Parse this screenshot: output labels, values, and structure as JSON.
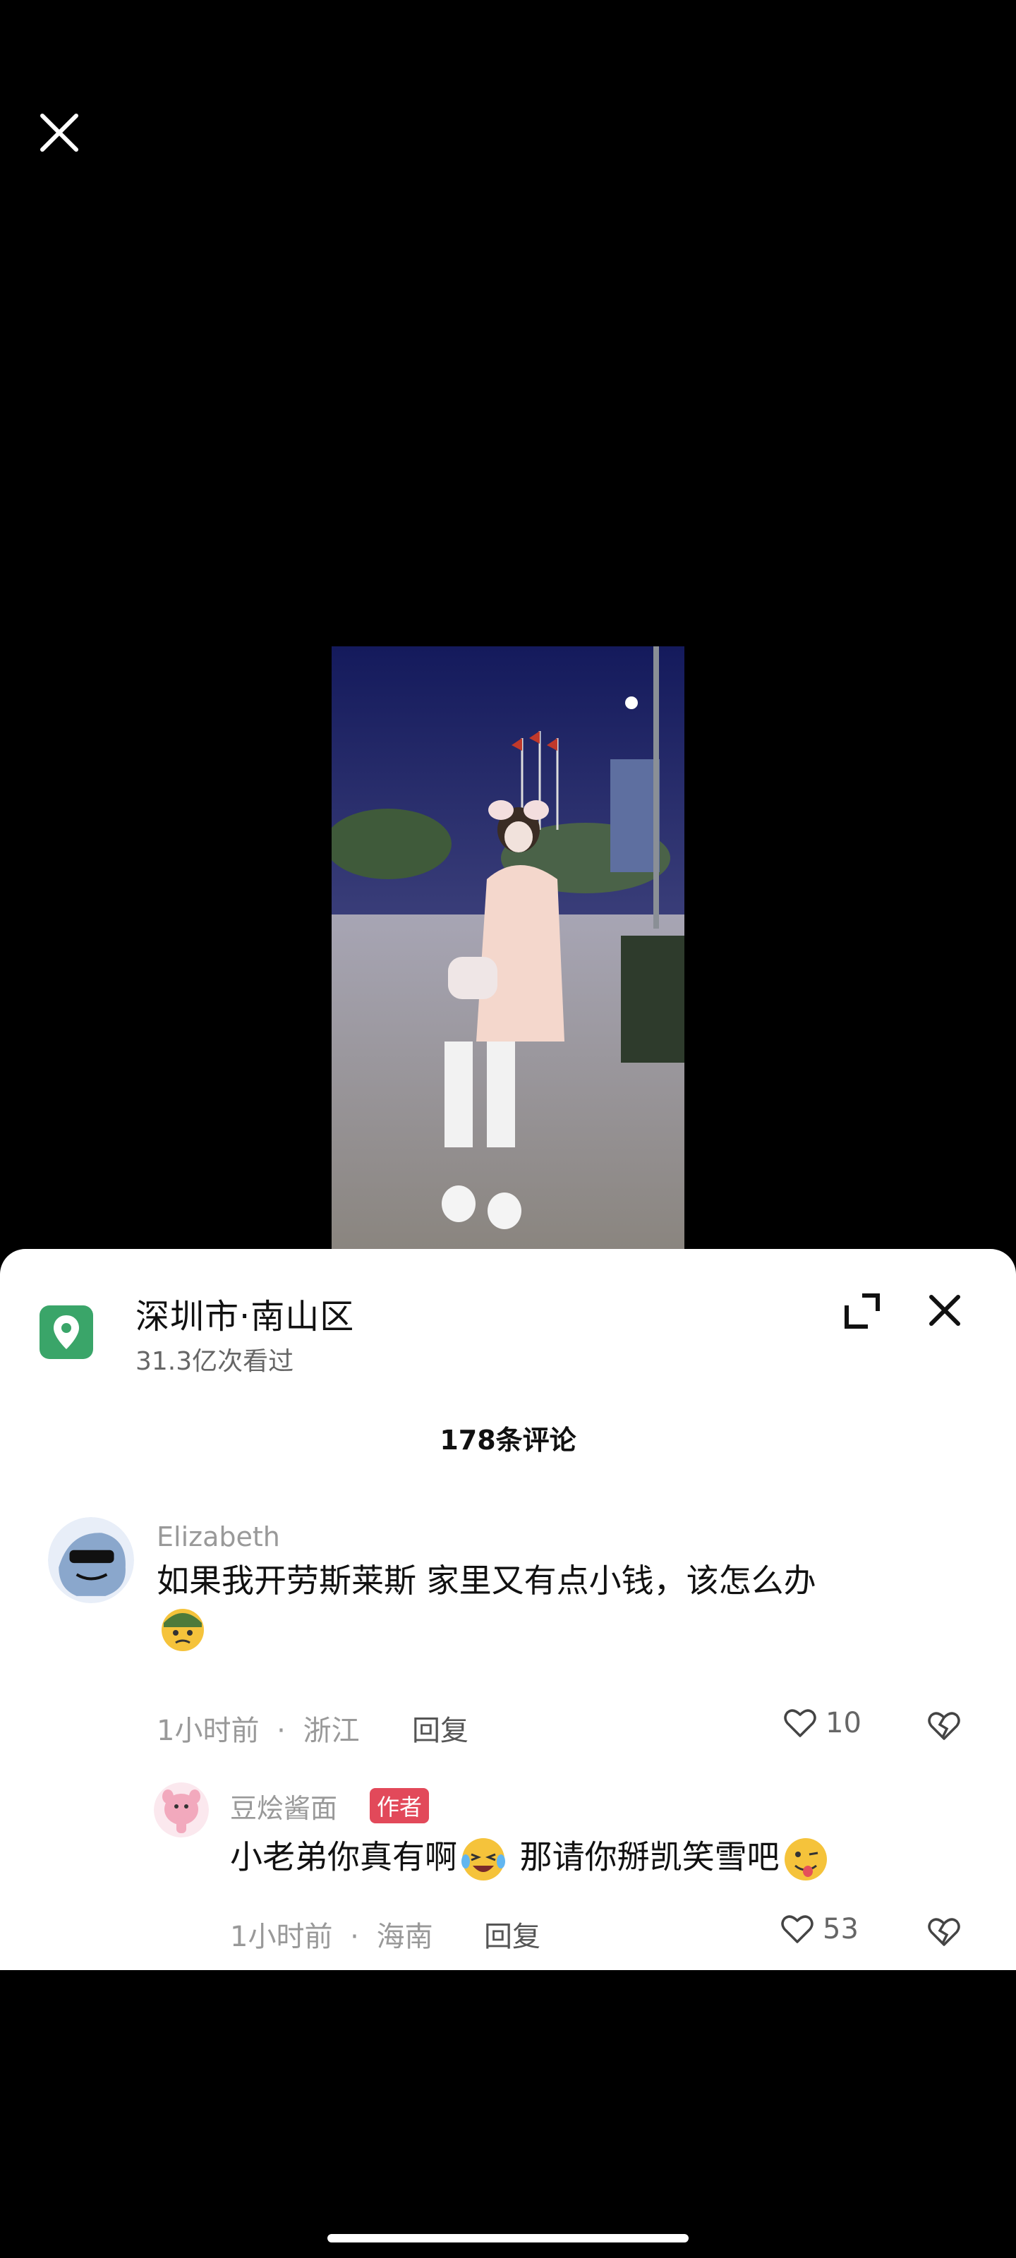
{
  "location": {
    "title": "深圳市·南山区",
    "views": "31.3亿次看过"
  },
  "comments_header": {
    "count_label": "178条评论"
  },
  "comments": [
    {
      "user": "Elizabeth",
      "text": "如果我开劳斯莱斯  家里又有点小钱，该怎么办",
      "time": "1小时前",
      "region": "浙江",
      "reply_label": "回复",
      "likes": "10"
    },
    {
      "user": "豆烩酱面",
      "badge": "作者",
      "text_part1": "小老弟你真有啊",
      "text_part2": " 那请你掰凯笑雪吧",
      "time": "1小时前",
      "region": "海南",
      "reply_label": "回复",
      "likes": "53"
    }
  ],
  "meta_separator": "·",
  "colors": {
    "location_icon": "#3aa569",
    "author_badge": "#e2495a"
  },
  "icons": [
    "close-icon",
    "location-pin-icon",
    "expand-icon",
    "heart-icon",
    "broken-heart-icon"
  ]
}
